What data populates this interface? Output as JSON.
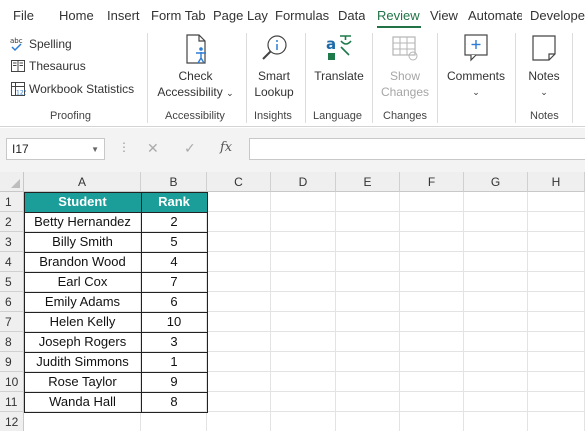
{
  "menu_tabs": [
    "File",
    "Home",
    "Insert",
    "Form Tab",
    "Page Lay",
    "Formulas",
    "Data",
    "Review",
    "View",
    "Automate",
    "Develope"
  ],
  "active_tab": "Review",
  "ribbon": {
    "proofing": {
      "spelling": "Spelling",
      "spelling_abc": "abc",
      "thesaurus": "Thesaurus",
      "workbook_statistics": "Workbook Statistics",
      "stats_123": "123",
      "label": "Proofing"
    },
    "accessibility": {
      "line1": "Check",
      "line2": "Accessibility",
      "label": "Accessibility"
    },
    "insights": {
      "line1": "Smart",
      "line2": "Lookup",
      "label": "Insights"
    },
    "language": {
      "line1": "Translate",
      "label": "Language"
    },
    "changes": {
      "line1": "Show",
      "line2": "Changes",
      "label": "Changes"
    },
    "comments": {
      "line1": "Comments"
    },
    "notes": {
      "line1": "Notes",
      "label": "Notes"
    }
  },
  "formula_bar": {
    "name_box": "I17",
    "fx": "fx",
    "cancel": "✕",
    "enter": "✓",
    "value": ""
  },
  "columns": [
    "A",
    "B",
    "C",
    "D",
    "E",
    "F",
    "G",
    "H"
  ],
  "rows": [
    "1",
    "2",
    "3",
    "4",
    "5",
    "6",
    "7",
    "8",
    "9",
    "10",
    "11",
    "12"
  ],
  "table": {
    "headers": [
      "Student",
      "Rank"
    ],
    "rows": [
      [
        "Betty Hernandez",
        "2"
      ],
      [
        "Billy Smith",
        "5"
      ],
      [
        "Brandon Wood",
        "4"
      ],
      [
        "Earl Cox",
        "7"
      ],
      [
        "Emily Adams",
        "6"
      ],
      [
        "Helen Kelly",
        "10"
      ],
      [
        "Joseph Rogers",
        "3"
      ],
      [
        "Judith Simmons",
        "1"
      ],
      [
        "Rose Taylor",
        "9"
      ],
      [
        "Wanda Hall",
        "8"
      ]
    ]
  },
  "colors": {
    "accent": "#217346",
    "table_header": "#1b9e9a"
  }
}
